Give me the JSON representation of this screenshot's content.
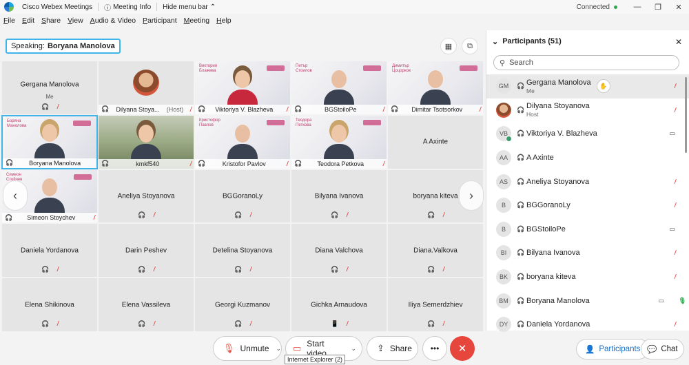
{
  "titlebar": {
    "app_name": "Cisco Webex Meetings",
    "meeting_info": "Meeting Info",
    "hide_menu": "Hide menu bar",
    "status": "Connected"
  },
  "menu": [
    "File",
    "Edit",
    "Share",
    "View",
    "Audio & Video",
    "Participant",
    "Meeting",
    "Help"
  ],
  "speaking": {
    "label": "Speaking:",
    "name": "Boryana Manolova"
  },
  "grid": [
    {
      "name": "Gergana Manolova",
      "sub": "Me",
      "kind": "plain"
    },
    {
      "name": "Dilyana Stoya...",
      "host": "(Host)",
      "kind": "avatar"
    },
    {
      "name": "Viktoriya V. Blazheva",
      "overlay": "Виктория\nБлажева",
      "kind": "video-f"
    },
    {
      "name": "BGStoilоPe",
      "overlay": "Петър\nСтоилов",
      "kind": "video-m"
    },
    {
      "name": "Dimitar Tsotsorkov",
      "overlay": "Димитър\nЦоцорков",
      "kind": "video-m"
    },
    {
      "name": "Boryana Manolova",
      "overlay": "Боряна\nМанолова",
      "kind": "video-f2",
      "active": true
    },
    {
      "name": "kmkf540",
      "kind": "nature"
    },
    {
      "name": "Kristofor Pavlov",
      "overlay": "Кристофор\nПавлов",
      "kind": "video-m"
    },
    {
      "name": "Teodora Petkova",
      "overlay": "Теодора\nПеткова",
      "kind": "video-f2"
    },
    {
      "name": "A Axinte",
      "kind": "plain-noicons"
    },
    {
      "name": "Simeon Stoychev",
      "overlay": "Симеон\nСтойчев",
      "kind": "video-m"
    },
    {
      "name": "Aneliya Stoyanova",
      "kind": "plain"
    },
    {
      "name": "BGGoranoLy",
      "kind": "plain"
    },
    {
      "name": "Bilyana Ivanova",
      "kind": "plain"
    },
    {
      "name": "boryana kiteva",
      "kind": "plain"
    },
    {
      "name": "Daniela Yordanova",
      "kind": "plain"
    },
    {
      "name": "Darin Peshev",
      "kind": "plain"
    },
    {
      "name": "Detelina Stoyanova",
      "kind": "plain"
    },
    {
      "name": "Diana Valchova",
      "kind": "plain"
    },
    {
      "name": "Diana.Valkova",
      "kind": "plain"
    },
    {
      "name": "Elena Shikinova",
      "kind": "plain"
    },
    {
      "name": "Elena Vassileva",
      "kind": "plain"
    },
    {
      "name": "Georgi Kuzmanov",
      "kind": "plain"
    },
    {
      "name": "Gichka Arnaudova",
      "kind": "plain-phone"
    },
    {
      "name": "Iliya Semerdzhiev",
      "kind": "plain"
    }
  ],
  "panel": {
    "title": "Participants (51)",
    "search_placeholder": "Search",
    "participants": [
      {
        "initials": "GM",
        "name": "Gergana Manolova",
        "sub": "Me",
        "state": "muted",
        "selected": true,
        "hand": true
      },
      {
        "initials": "",
        "name": "Dilyana Stoyanova",
        "sub": "Host",
        "state": "muted",
        "photo": true
      },
      {
        "initials": "VB",
        "name": "Viktoriya V. Blazheva",
        "state": "camera"
      },
      {
        "initials": "AA",
        "name": "A Axinte",
        "state": ""
      },
      {
        "initials": "AS",
        "name": "Aneliya Stoyanova",
        "state": "muted"
      },
      {
        "initials": "B",
        "name": "BGGoranoLy",
        "state": "muted"
      },
      {
        "initials": "B",
        "name": "BGStoiloPe",
        "state": "camera"
      },
      {
        "initials": "BI",
        "name": "Bilyana Ivanova",
        "state": "muted"
      },
      {
        "initials": "BK",
        "name": "boryana kiteva",
        "state": "muted"
      },
      {
        "initials": "BM",
        "name": "Boryana Manolova",
        "state": "camera-mic"
      },
      {
        "initials": "DY",
        "name": "Daniela Yordanova",
        "state": "muted"
      }
    ]
  },
  "controls": {
    "unmute": "Unmute",
    "start_video": "Start video",
    "share": "Share",
    "tooltip": "Internet Explorer (2)",
    "participants_tab": "Participants",
    "chat_tab": "Chat"
  },
  "colors": {
    "accent": "#3fb4e8",
    "leave": "#e6463c",
    "muted": "#e0493c"
  }
}
